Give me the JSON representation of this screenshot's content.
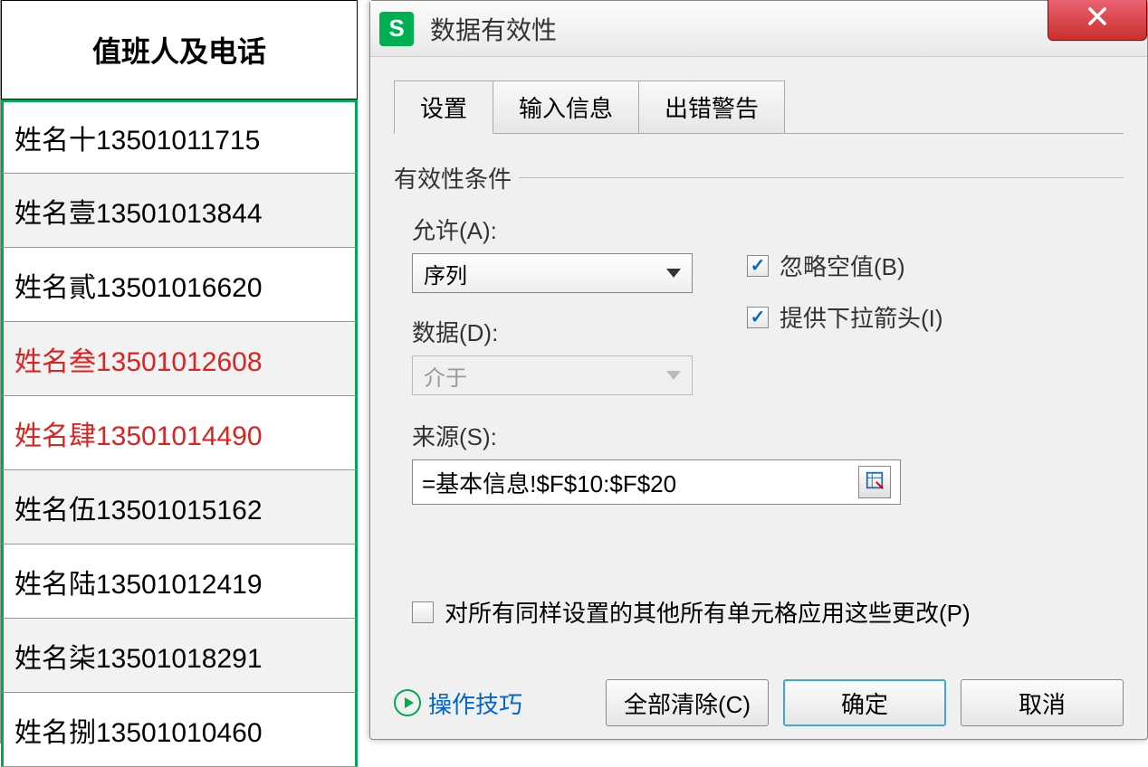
{
  "sheet": {
    "header": "值班人及电话",
    "rows": [
      {
        "text": "姓名十13501011715",
        "red": false,
        "alt": false
      },
      {
        "text": "姓名壹13501013844",
        "red": false,
        "alt": true
      },
      {
        "text": "姓名貳13501016620",
        "red": false,
        "alt": false
      },
      {
        "text": "姓名叁13501012608",
        "red": true,
        "alt": true
      },
      {
        "text": "姓名肆13501014490",
        "red": true,
        "alt": false
      },
      {
        "text": "姓名伍13501015162",
        "red": false,
        "alt": true
      },
      {
        "text": "姓名陆13501012419",
        "red": false,
        "alt": false
      },
      {
        "text": "姓名柒13501018291",
        "red": false,
        "alt": true
      },
      {
        "text": "姓名捌13501010460",
        "red": false,
        "alt": false
      }
    ]
  },
  "dialog": {
    "app_icon": "S",
    "title": "数据有效性",
    "tabs": [
      "设置",
      "输入信息",
      "出错警告"
    ],
    "group_label": "有效性条件",
    "allow_label": "允许(A):",
    "allow_value": "序列",
    "data_label": "数据(D):",
    "data_value": "介于",
    "ignore_blank": "忽略空值(B)",
    "dropdown_arrow": "提供下拉箭头(I)",
    "source_label": "来源(S):",
    "source_value": "=基本信息!$F$10:$F$20",
    "apply_all": "对所有同样设置的其他所有单元格应用这些更改(P)",
    "tips": "操作技巧",
    "clear_all": "全部清除(C)",
    "ok": "确定",
    "cancel": "取消"
  }
}
